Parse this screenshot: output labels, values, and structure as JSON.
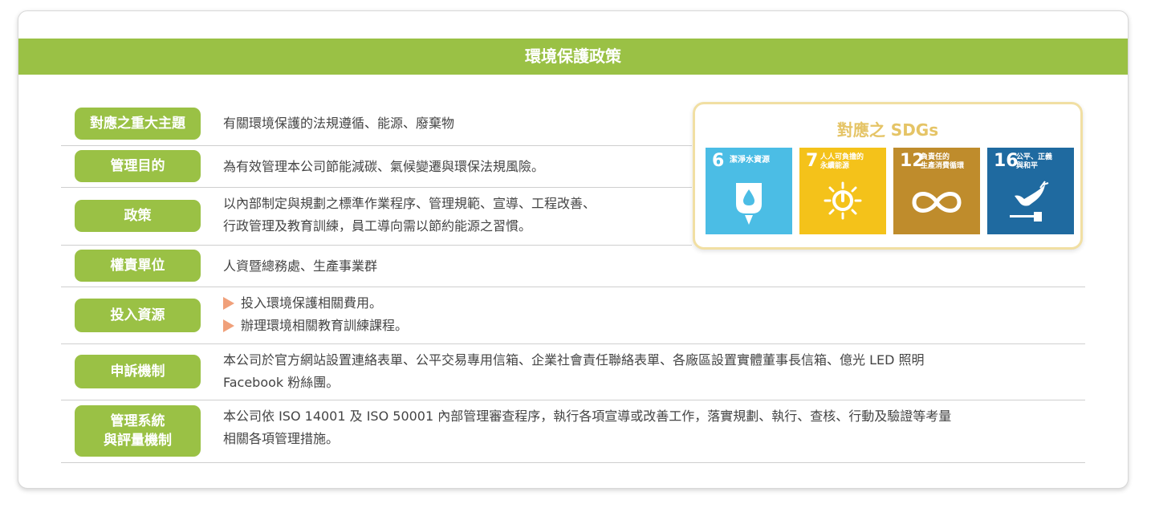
{
  "header": {
    "title": "環境保護政策"
  },
  "rows": [
    {
      "label": "對應之重大主題",
      "text": [
        "有關環境保護的法規遵循、能源、廢棄物"
      ]
    },
    {
      "label": "管理目的",
      "text": [
        "為有效管理本公司節能減碳、氣候變遷與環保法規風險。"
      ]
    },
    {
      "label": "政策",
      "text": [
        "以內部制定與規劃之標準作業程序、管理規範、宣導、工程改善、",
        "行政管理及教育訓練，員工導向需以節約能源之習慣。"
      ]
    },
    {
      "label": "權責單位",
      "text": [
        "人資暨總務處、生產事業群"
      ]
    },
    {
      "label": "投入資源",
      "bullets": [
        "投入環境保護相關費用。",
        "辦理環境相關教育訓練課程。"
      ]
    },
    {
      "label": "申訴機制",
      "text": [
        "本公司於官方網站設置連絡表單、公平交易專用信箱、企業社會責任聯絡表單、各廠區設置實體董事長信箱、億光 LED 照明",
        "Facebook 粉絲團。"
      ]
    },
    {
      "label_lines": [
        "管理系統",
        "與評量機制"
      ],
      "text": [
        "本公司依 ISO 14001 及 ISO 50001 內部管理審查程序，執行各項宣導或改善工作，落實規劃、執行、查核、行動及驗證等考量",
        "相關各項管理措施。"
      ]
    }
  ],
  "sdgs": {
    "title": "對應之 SDGs",
    "tiles": [
      {
        "number": "6",
        "label": [
          "潔淨水資源"
        ],
        "color": "#4bbde5",
        "icon": "water-drop-icon"
      },
      {
        "number": "7",
        "label": [
          "人人可負擔的",
          "永續能源"
        ],
        "color": "#f4c21a",
        "icon": "sun-power-icon"
      },
      {
        "number": "12",
        "label": [
          "負責任的",
          "生產消費循環"
        ],
        "color": "#bf8c2c",
        "icon": "infinity-icon"
      },
      {
        "number": "16",
        "label": [
          "公平、正義",
          "與和平"
        ],
        "color": "#1f6aa0",
        "icon": "dove-icon"
      }
    ]
  }
}
